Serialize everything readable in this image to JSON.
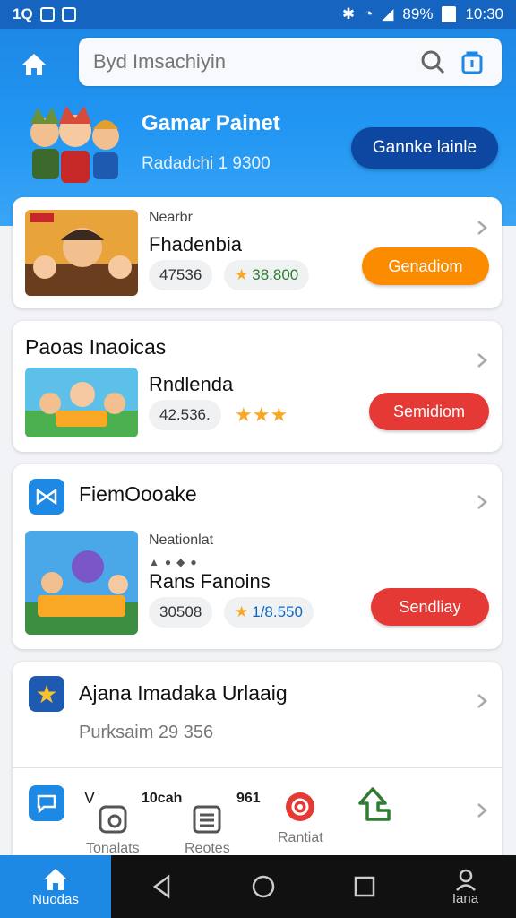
{
  "status_bar": {
    "left_text": "1Q",
    "battery": "89%",
    "time": "10:30"
  },
  "search": {
    "placeholder": "Byd Imsachiyin"
  },
  "banner": {
    "title": "Gamar Painet",
    "subtitle": "Radadchi 1 9300",
    "button_label": "Gannke lainle"
  },
  "card1": {
    "category": "Nearbr",
    "name": "Fhadenbia",
    "count": "47536",
    "rating": "38.800",
    "button_label": "Genadiom",
    "button_color": "#fb8c00"
  },
  "card2": {
    "title": "Paoas Inaoicas",
    "name": "Rndlenda",
    "count": "42.536.",
    "button_label": "Semidiom",
    "button_color": "#e53935"
  },
  "card3": {
    "title": "FiemOooake",
    "category": "Neationlat",
    "name": "Rans Fanoins",
    "count": "30508",
    "rating": "1/8.550",
    "button_label": "Sendliay",
    "button_color": "#e53935"
  },
  "card4": {
    "title": "Ajana Imadaka Urlaaig",
    "subtitle": "Purksaim 29 356",
    "items": [
      {
        "label": "Tonalats",
        "icon": "gallery-icon"
      },
      {
        "label": "10cah",
        "icon": ""
      },
      {
        "label": "Reotes",
        "icon": "list-icon"
      },
      {
        "label": "961",
        "icon": ""
      },
      {
        "label": "Rantiat",
        "icon": "target-icon"
      },
      {
        "label": "",
        "icon": "arrow-icon"
      }
    ],
    "stray_char": "V"
  },
  "nav": {
    "home_label": "Nuodas",
    "profile_label": "Iana"
  },
  "colors": {
    "primary": "#1e88e5",
    "dark_button": "#0d47a1",
    "orange": "#fb8c00",
    "red": "#e53935"
  }
}
